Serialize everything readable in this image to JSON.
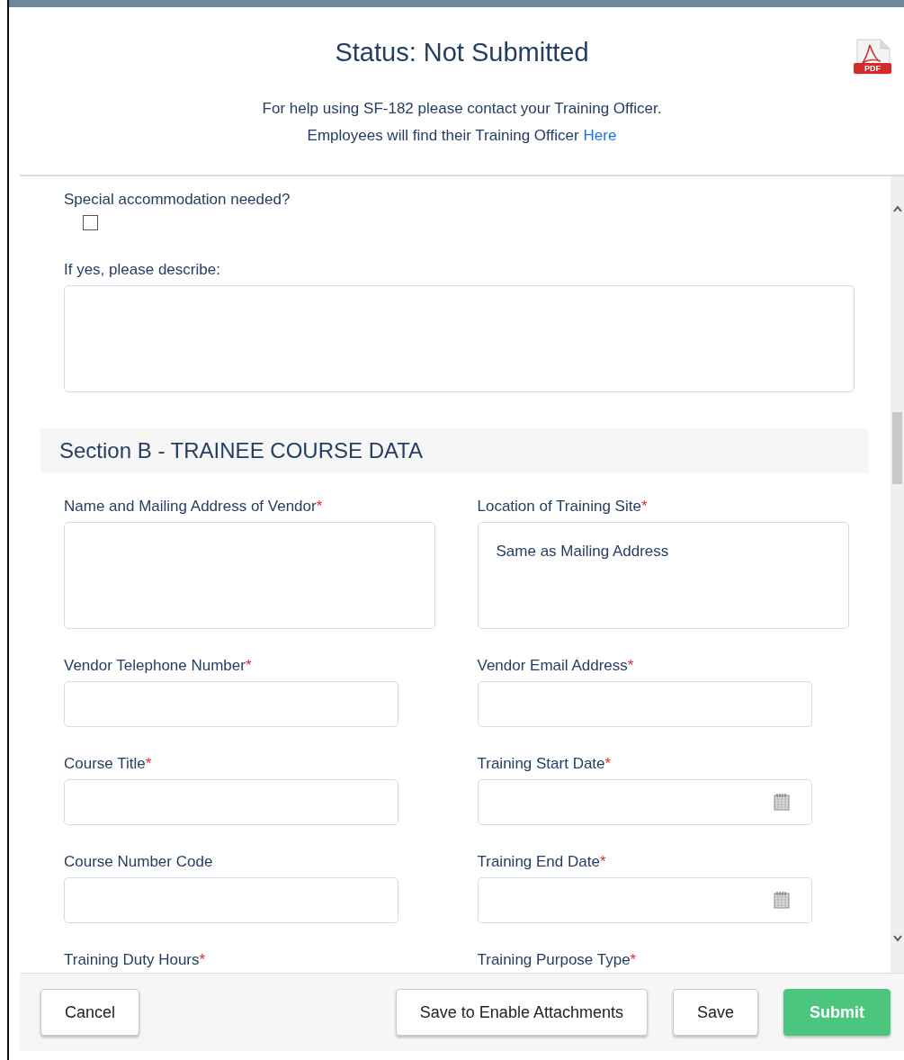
{
  "header": {
    "status": "Status: Not Submitted",
    "help_text": "For help using SF-182 please contact your Training Officer.",
    "finder_text": "Employees will find their Training Officer",
    "finder_link": "Here",
    "pdf_label": "PDF"
  },
  "accommodation": {
    "label": "Special accommodation needed?",
    "checked": false
  },
  "description": {
    "label": "If yes, please describe:"
  },
  "section": {
    "title": "Section B - TRAINEE COURSE DATA"
  },
  "required_mark": "*",
  "rows": [
    {
      "fields": [
        {
          "label": "Name and Mailing Address of Vendor",
          "required": true,
          "kind": "textarea"
        },
        {
          "label": "Location of Training Site",
          "required": true,
          "kind": "textarea",
          "value": "Same as Mailing Address"
        }
      ]
    },
    {
      "fields": [
        {
          "label": "Vendor Telephone Number",
          "required": true,
          "kind": "text"
        },
        {
          "label": "Vendor Email Address",
          "required": true,
          "kind": "text"
        }
      ]
    },
    {
      "fields": [
        {
          "label": "Course Title",
          "required": true,
          "kind": "text"
        },
        {
          "label": "Training Start Date",
          "required": true,
          "kind": "date"
        }
      ]
    },
    {
      "fields": [
        {
          "label": "Course Number Code",
          "required": false,
          "kind": "text"
        },
        {
          "label": "Training End Date",
          "required": true,
          "kind": "date"
        }
      ]
    },
    {
      "fields": [
        {
          "label": "Training Duty Hours",
          "required": true
        },
        {
          "label": "Training Purpose Type",
          "required": true
        }
      ]
    }
  ],
  "footer": {
    "left_buttons": [
      {
        "label": "Cancel",
        "kind": "default"
      }
    ],
    "right_buttons": [
      {
        "label": "Save to Enable Attachments",
        "kind": "default"
      },
      {
        "label": "Save",
        "kind": "default"
      },
      {
        "label": "Submit",
        "kind": "primary"
      }
    ]
  }
}
